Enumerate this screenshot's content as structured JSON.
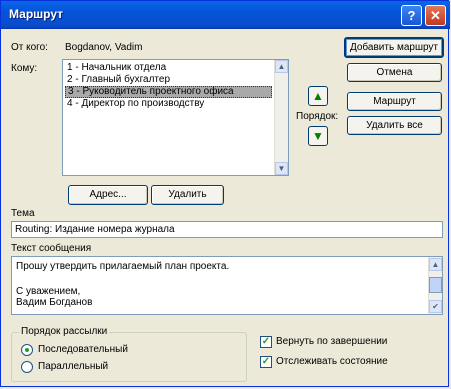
{
  "window": {
    "title": "Маршрут",
    "help_button": "?",
    "close_button": "✕"
  },
  "from": {
    "label": "От кого:",
    "value": "Bogdanov, Vadim"
  },
  "to": {
    "label": "Кому:",
    "items": [
      "1 - Начальник отдела",
      "2 - Главный бухгалтер",
      "3 - Руководитель проектного офиса",
      "4 - Директор по производству"
    ],
    "selected_index": 2
  },
  "buttons": {
    "add_route": "Добавить маршрут",
    "cancel": "Отмена",
    "route": "Маршрут",
    "remove_all": "Удалить все",
    "address": "Адрес...",
    "remove": "Удалить"
  },
  "order": {
    "label": "Порядок:",
    "up_icon": "▲",
    "down_icon": "▼"
  },
  "subject": {
    "label": "Тема",
    "value": "Routing: Издание номера журнала"
  },
  "message": {
    "label": "Текст сообщения",
    "lines": [
      "Прошу утвердить прилагаемый план проекта.",
      "",
      "С уважением,",
      "Вадим Богданов"
    ]
  },
  "delivery": {
    "legend": "Порядок рассылки",
    "options": [
      "Последовательный",
      "Параллельный"
    ],
    "selected": "Последовательный"
  },
  "options": {
    "return_when_done": "Вернуть по завершении",
    "track_status": "Отслеживать состояние",
    "return_checked": true,
    "track_checked": true
  },
  "scroll": {
    "up": "▲",
    "down": "▼",
    "check": "✔"
  }
}
